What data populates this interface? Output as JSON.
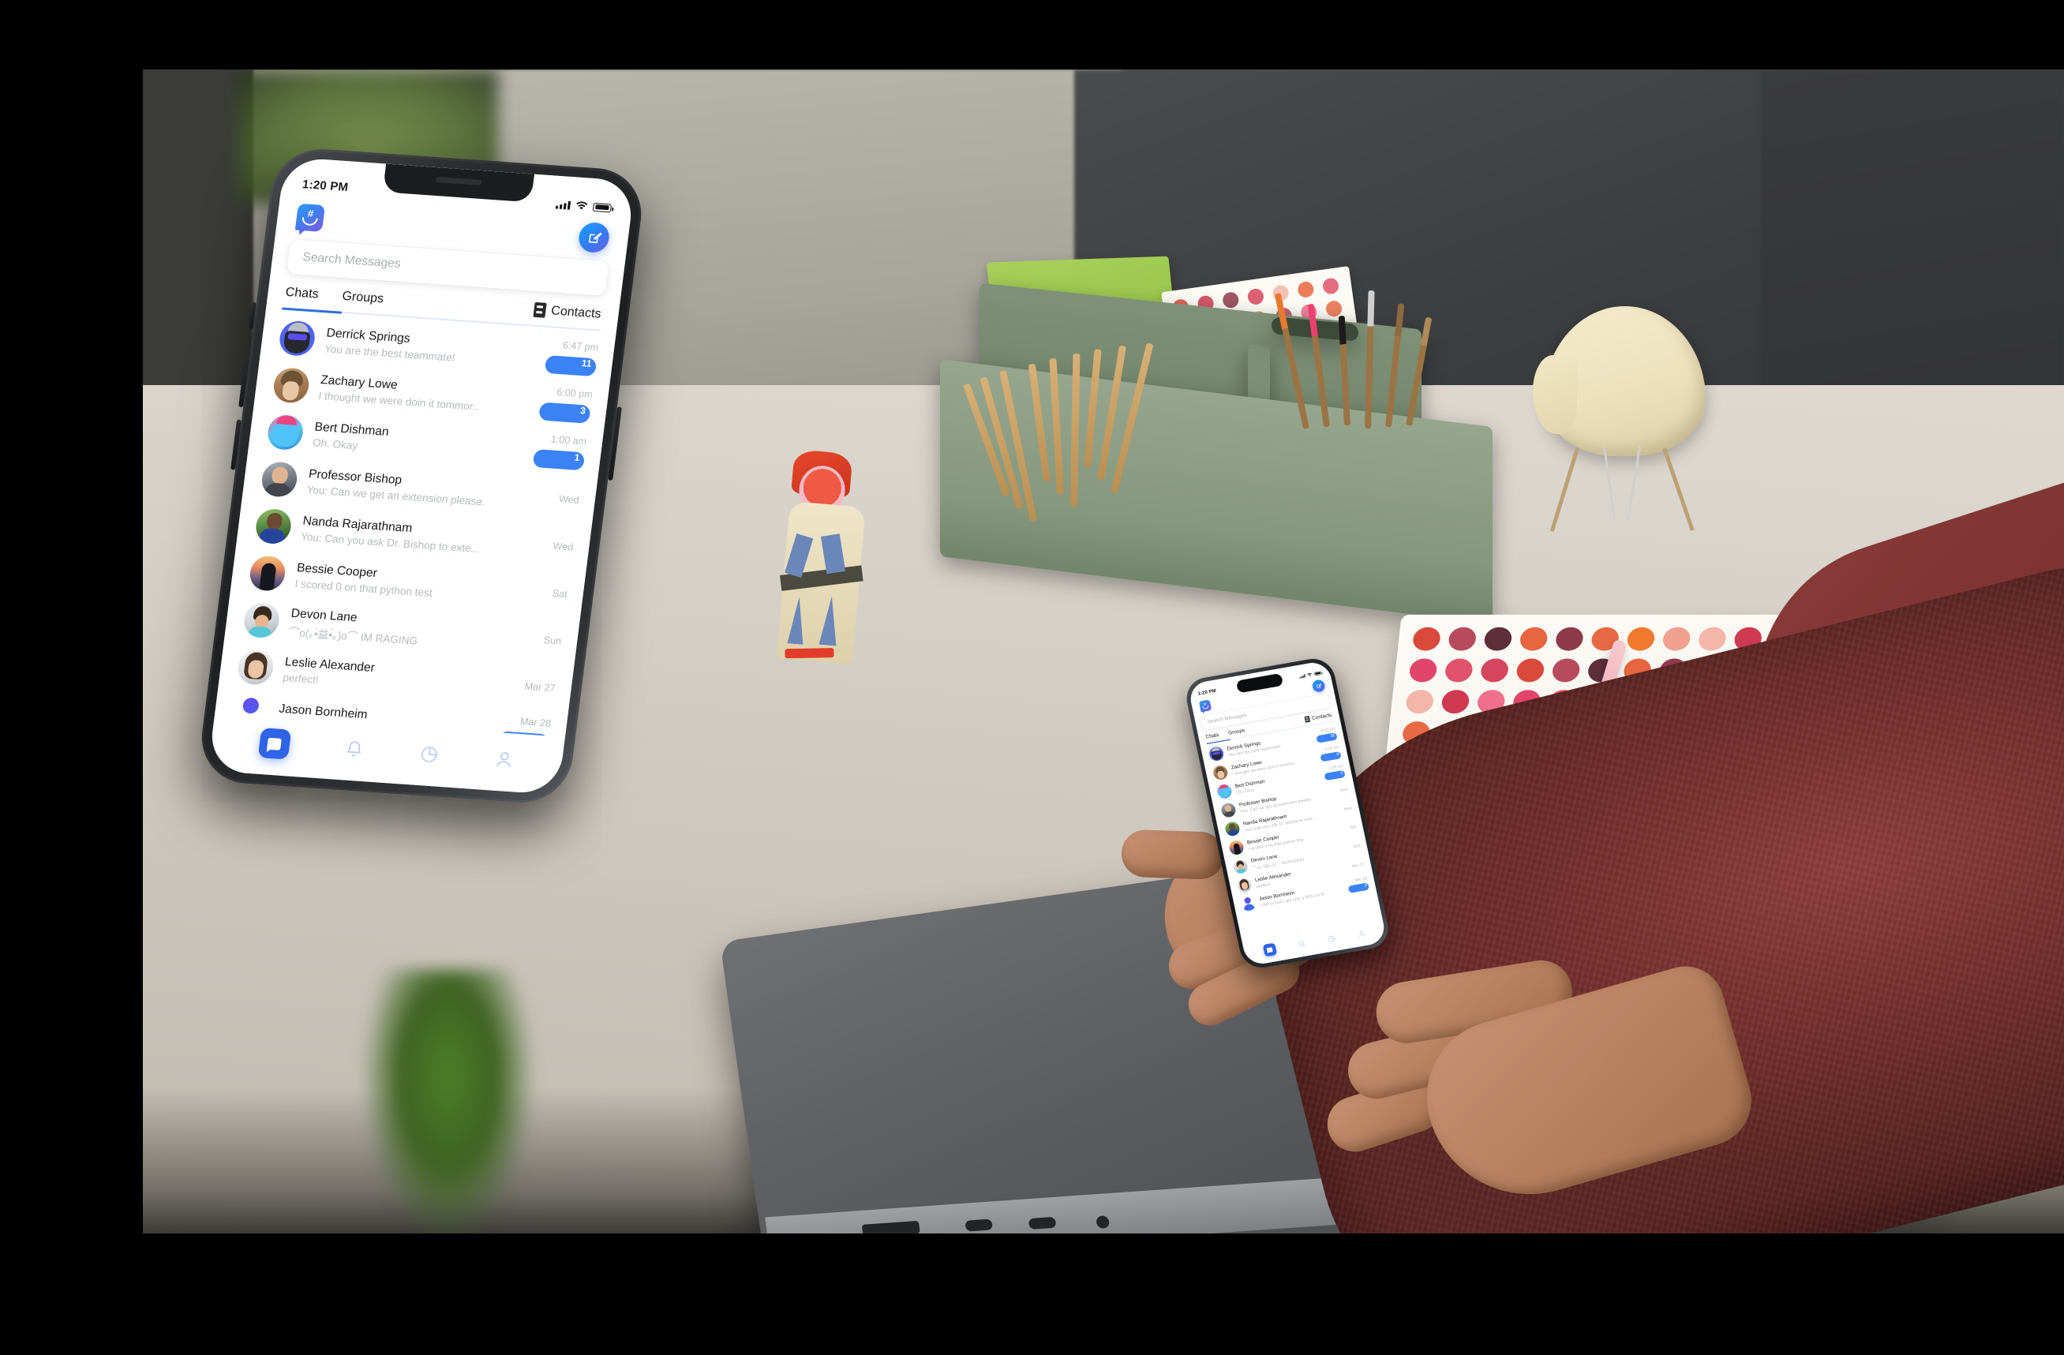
{
  "scene": {
    "description": "Desk workspace product mockup with two phones running a messaging app",
    "objects": [
      "desk-organizer",
      "mini-eames-chair",
      "polka-dot-notebook",
      "pink-pen",
      "wooden-figurine",
      "macbook-pro",
      "plant"
    ]
  },
  "app": {
    "statusbar": {
      "time": "1:20 PM",
      "signal_icon": "cellular-bars-icon",
      "wifi_icon": "wifi-icon",
      "battery_icon": "battery-icon"
    },
    "appbar": {
      "logo_name": "app-logo-speech-bubble-smiley",
      "compose_label": "compose-icon"
    },
    "search": {
      "placeholder": "Search Messages",
      "value": ""
    },
    "tabs": [
      {
        "label": "Chats",
        "active": true
      },
      {
        "label": "Groups",
        "active": false
      }
    ],
    "contacts_tab": {
      "label": "Contacts",
      "icon": "address-book-icon"
    },
    "chats": [
      {
        "name": "Derrick Springs",
        "preview": "You are the best teammate!",
        "time": "6:47 pm",
        "badge": "11",
        "avatar": "av-derrick"
      },
      {
        "name": "Zachary Lowe",
        "preview": "I thought we were doin it tommor..",
        "time": "6:00 pm",
        "badge": "3",
        "avatar": "av-zach"
      },
      {
        "name": "Bert Dishman",
        "preview": "Oh. Okay",
        "time": "1:00 am",
        "badge": "1",
        "avatar": "av-bert"
      },
      {
        "name": "Professor Bishop",
        "preview": "You: Can we get an extension please.",
        "time": "Wed",
        "badge": "",
        "avatar": "av-bishop"
      },
      {
        "name": "Nanda Rajarathnam",
        "preview": "You: Can you ask Dr. Bishop to exte...",
        "time": "Wed",
        "badge": "",
        "avatar": "av-nanda"
      },
      {
        "name": "Bessie Cooper",
        "preview": "I scored 0 on that python test",
        "time": "Sat",
        "badge": "",
        "avatar": "av-bessie"
      },
      {
        "name": "Devon Lane",
        "preview": "⌒o(｡•̀益•́｡)o⌒ IM RAGING",
        "time": "Sun",
        "badge": "",
        "avatar": "av-devon"
      },
      {
        "name": "Leslie Alexander",
        "preview": "perfect!",
        "time": "Mar 27",
        "badge": "",
        "avatar": "av-leslie"
      },
      {
        "name": "Jason Bornheim",
        "preview": "I did so bad i got only a 95% on it!",
        "time": "Mar 28",
        "badge": "1",
        "avatar": "av-jason"
      }
    ],
    "navbar": [
      {
        "icon": "chat-bubble-icon",
        "active": true
      },
      {
        "icon": "bell-icon",
        "active": false
      },
      {
        "icon": "pie-chart-icon",
        "active": false
      },
      {
        "icon": "person-icon",
        "active": false
      }
    ]
  },
  "colors": {
    "accent_blue": "#3b82f6",
    "nav_active_blue": "#2f63e8",
    "tab_underline": "#2f6fe0",
    "muted_text": "#b6b9be",
    "logo_gradient_start": "#2f9bf5",
    "logo_gradient_end": "#7b5ce8",
    "sweater_maroon": "#78322f",
    "desk_cream": "#d6d1c8",
    "caddy_sage": "#8a9b83"
  }
}
